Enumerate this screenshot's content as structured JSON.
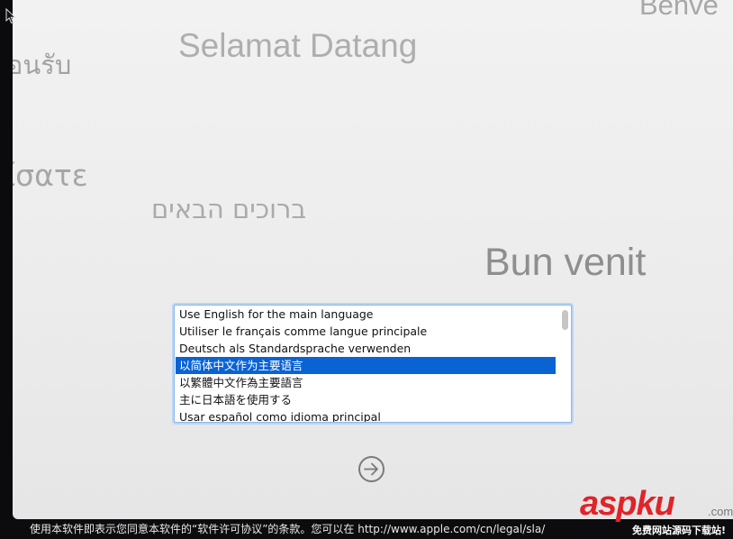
{
  "greetings": {
    "selamat": "Selamat Datang",
    "thai": "อนรับ",
    "greek": "ίσατε",
    "hebrew": "ברוכים הבאים",
    "romanian": "Bun venit",
    "italian": "Benve"
  },
  "language_list": {
    "items": [
      "Use English for the main language",
      "Utiliser le français comme langue principale",
      "Deutsch als Standardsprache verwenden",
      "以简体中文作为主要语言",
      "以繁體中文作為主要語言",
      "主に日本語を使用する",
      "Usar español como idioma principal"
    ],
    "selected_index": 3
  },
  "continue_button": {
    "icon": "arrow-right-circle-icon"
  },
  "footer": {
    "license_text": "使用本软件即表示您同意本软件的“软件许可协议”的条款。您可以在 http://www.apple.com/cn/legal/sla/"
  },
  "watermark": {
    "logo": "aspku",
    "dotcom": ".com",
    "tagline": "免费网站源码下载站!"
  },
  "colors": {
    "selection": "#0a63d3",
    "list_focus_ring": "#8fb8e8",
    "watermark_red": "#e0242a"
  }
}
